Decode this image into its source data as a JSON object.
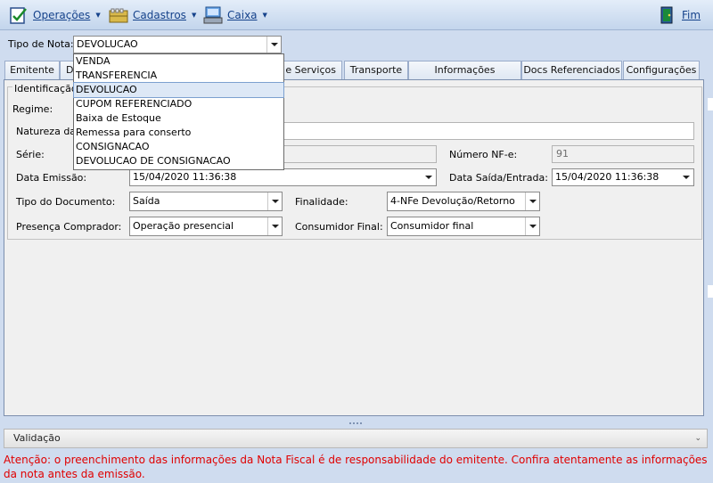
{
  "menu": {
    "operacoes": "Operações",
    "cadastros": "Cadastros",
    "caixa": "Caixa",
    "fim": "Fim"
  },
  "tipo_nota": {
    "label": "Tipo de Nota:",
    "value": "DEVOLUCAO",
    "options": [
      "VENDA",
      "TRANSFERENCIA",
      "DEVOLUCAO",
      "CUPOM REFERENCIADO",
      "Baixa de Estoque",
      "Remessa para conserto",
      "CONSIGNACAO",
      "DEVOLUCAO DE CONSIGNACAO"
    ]
  },
  "tabs": [
    "Emitente",
    "D",
    "s e Serviços",
    "Transporte",
    "Informações Adicionais",
    "Docs Referenciados",
    "Configurações"
  ],
  "identificacao": {
    "title": "Identificação",
    "regime_label": "Regime:",
    "natureza_label": "Natureza da O",
    "serie_label": "Série:",
    "numero_label": "Número NF-e:",
    "numero_value": "91",
    "data_emissao_label": "Data Emissão:",
    "data_emissao_value": "15/04/2020 11:36:38",
    "data_saida_label": "Data Saída/Entrada:",
    "data_saida_value": "15/04/2020 11:36:38",
    "tipo_doc_label": "Tipo do Documento:",
    "tipo_doc_value": "Saída",
    "finalidade_label": "Finalidade:",
    "finalidade_value": "4-NFe Devolução/Retorno",
    "presenca_label": "Presença Comprador:",
    "presenca_value": "Operação presencial",
    "consumidor_label": "Consumidor Final:",
    "consumidor_value": "Consumidor final"
  },
  "validacao": "Validação",
  "warning": "Atenção: o preenchimento das informações da Nota Fiscal é de responsabilidade do emitente. Confira atentamente as informações da nota antes da emissão.",
  "colors": {
    "menu_text": "#15428b",
    "warning": "#e00000",
    "background": "#cfdcef"
  },
  "icons": [
    "operacoes-icon",
    "cadastros-icon",
    "caixa-icon",
    "fim-icon"
  ]
}
